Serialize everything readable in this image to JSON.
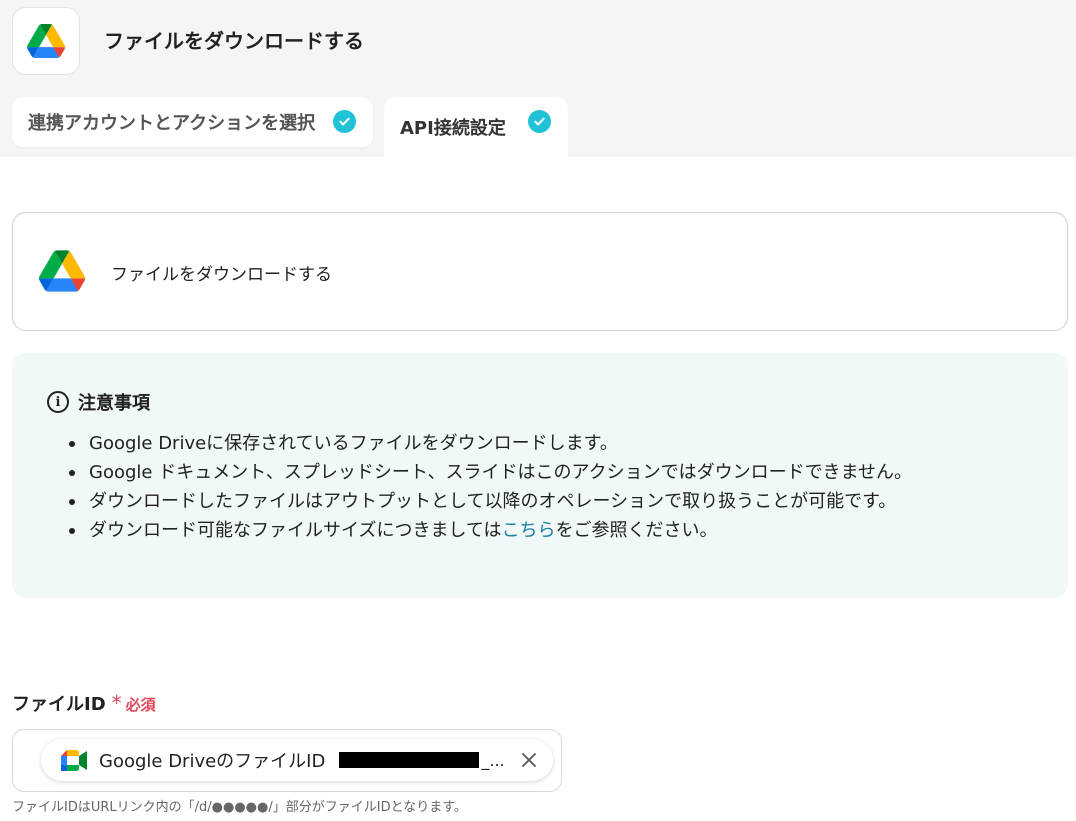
{
  "header": {
    "title": "ファイルをダウンロードする",
    "app_icon": "google-drive-icon"
  },
  "tabs": [
    {
      "label": "連携アカウントとアクションを選択",
      "status": "complete"
    },
    {
      "label": "API接続設定",
      "status": "complete"
    }
  ],
  "action": {
    "title": "ファイルをダウンロードする",
    "icon": "google-drive-icon"
  },
  "notice": {
    "title": "注意事項",
    "items": [
      "Google Driveに保存されているファイルをダウンロードします。",
      "Google ドキュメント、スプレッドシート、スライドはこのアクションではダウンロードできません。",
      "ダウンロードしたファイルはアウトプットとして以降のオペレーションで取り扱うことが可能です。"
    ],
    "item4_before": "ダウンロード可能なファイルサイズにつきましては",
    "item4_link": "こちら",
    "item4_after": "をご参照ください。"
  },
  "field": {
    "label": "ファイルID",
    "required_mark": "*",
    "required_label": "必須",
    "chip_text": "Google DriveのファイルID",
    "chip_suffix": "_...",
    "chip_icon": "google-meet-icon",
    "help": "ファイルIDはURLリンク内の「/d/●●●●●/」部分がファイルIDとなります。"
  },
  "colors": {
    "accent_check": "#1fc2d6",
    "required": "#e0475a",
    "link": "#1a7fa0",
    "notice_bg": "#f1f8f8",
    "header_bg": "#f5f5f5"
  }
}
